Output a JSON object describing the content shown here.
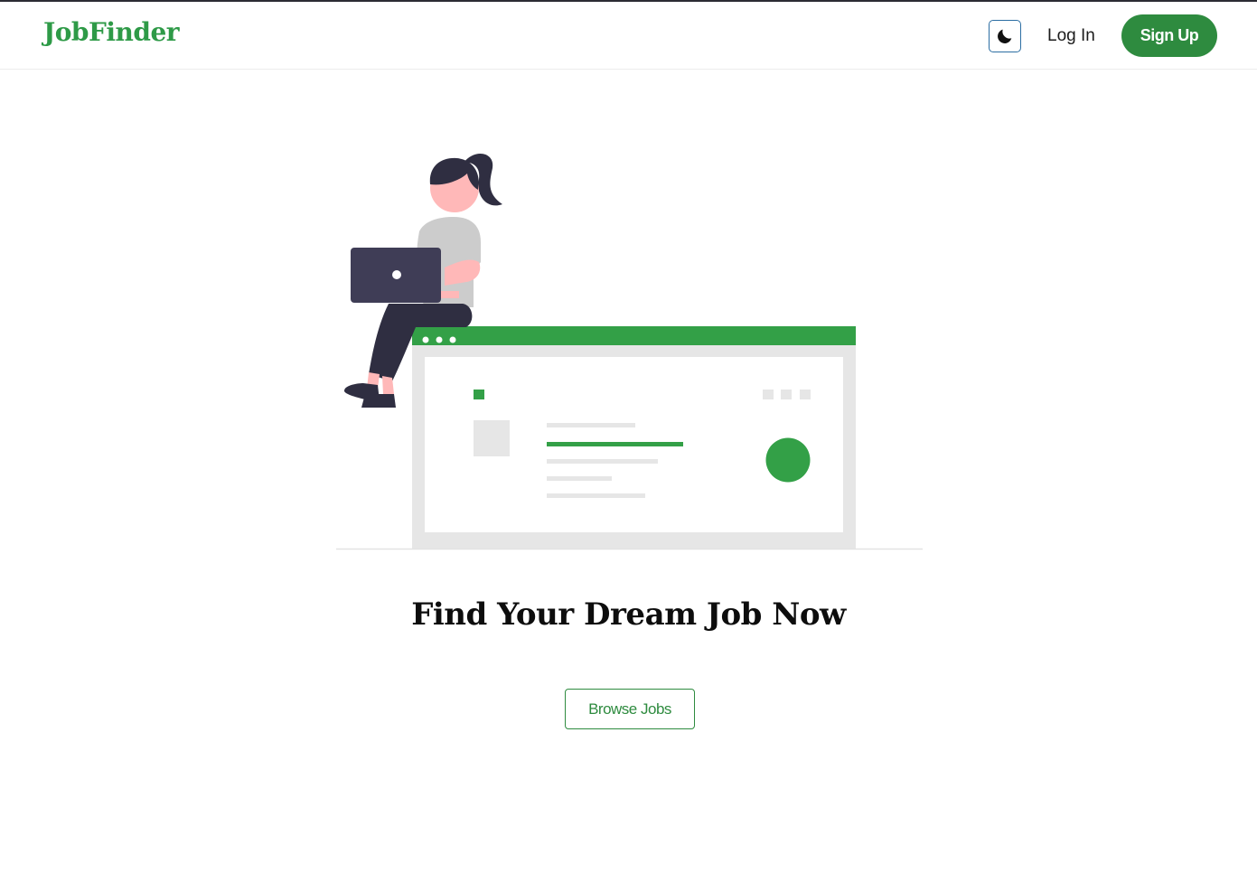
{
  "header": {
    "logo": "JobFinder",
    "theme_toggle_icon": "moon-icon",
    "login_label": "Log In",
    "signup_label": "Sign Up"
  },
  "hero": {
    "title": "Find Your Dream Job Now",
    "browse_label": "Browse Jobs",
    "illustration": "woman-with-laptop-sitting-on-browser-window"
  },
  "colors": {
    "brand_green": "#2e9a47",
    "button_green": "#2e8b3f",
    "dark": "#2f2e41"
  }
}
